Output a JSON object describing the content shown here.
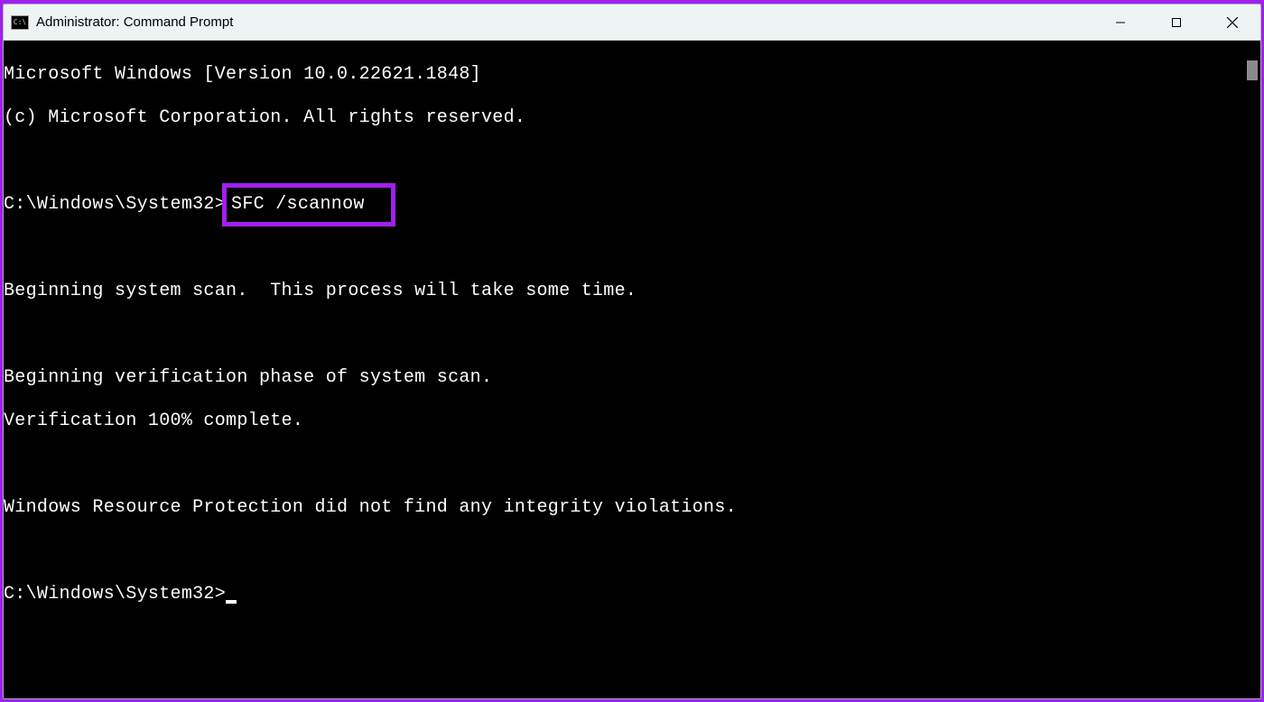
{
  "window": {
    "title": "Administrator: Command Prompt",
    "icon_label": "C:\\"
  },
  "terminal": {
    "line1": "Microsoft Windows [Version 10.0.22621.1848]",
    "line2": "(c) Microsoft Corporation. All rights reserved.",
    "blank1": "",
    "prompt1_path": "C:\\Windows\\System32>",
    "prompt1_cmd": "SFC /scannow",
    "blank2": "",
    "line3": "Beginning system scan.  This process will take some time.",
    "blank3": "",
    "line4": "Beginning verification phase of system scan.",
    "line5": "Verification 100% complete.",
    "blank4": "",
    "line6": "Windows Resource Protection did not find any integrity violations.",
    "blank5": "",
    "prompt2_path": "C:\\Windows\\System32>"
  },
  "highlight": {
    "color": "#a020f0"
  }
}
